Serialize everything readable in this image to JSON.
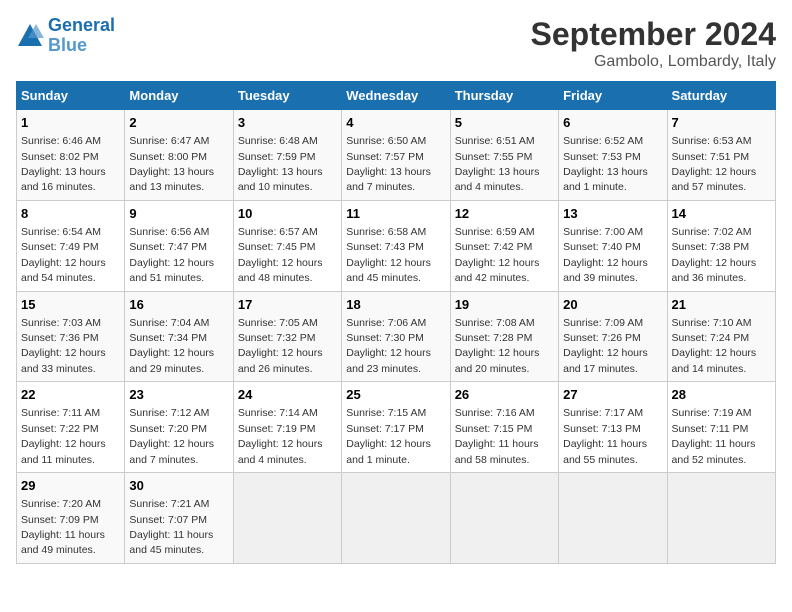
{
  "logo": {
    "line1": "General",
    "line2": "Blue"
  },
  "title": "September 2024",
  "subtitle": "Gambolo, Lombardy, Italy",
  "headers": [
    "Sunday",
    "Monday",
    "Tuesday",
    "Wednesday",
    "Thursday",
    "Friday",
    "Saturday"
  ],
  "weeks": [
    [
      {
        "day": "1",
        "sunrise": "Sunrise: 6:46 AM",
        "sunset": "Sunset: 8:02 PM",
        "daylight": "Daylight: 13 hours and 16 minutes."
      },
      {
        "day": "2",
        "sunrise": "Sunrise: 6:47 AM",
        "sunset": "Sunset: 8:00 PM",
        "daylight": "Daylight: 13 hours and 13 minutes."
      },
      {
        "day": "3",
        "sunrise": "Sunrise: 6:48 AM",
        "sunset": "Sunset: 7:59 PM",
        "daylight": "Daylight: 13 hours and 10 minutes."
      },
      {
        "day": "4",
        "sunrise": "Sunrise: 6:50 AM",
        "sunset": "Sunset: 7:57 PM",
        "daylight": "Daylight: 13 hours and 7 minutes."
      },
      {
        "day": "5",
        "sunrise": "Sunrise: 6:51 AM",
        "sunset": "Sunset: 7:55 PM",
        "daylight": "Daylight: 13 hours and 4 minutes."
      },
      {
        "day": "6",
        "sunrise": "Sunrise: 6:52 AM",
        "sunset": "Sunset: 7:53 PM",
        "daylight": "Daylight: 13 hours and 1 minute."
      },
      {
        "day": "7",
        "sunrise": "Sunrise: 6:53 AM",
        "sunset": "Sunset: 7:51 PM",
        "daylight": "Daylight: 12 hours and 57 minutes."
      }
    ],
    [
      {
        "day": "8",
        "sunrise": "Sunrise: 6:54 AM",
        "sunset": "Sunset: 7:49 PM",
        "daylight": "Daylight: 12 hours and 54 minutes."
      },
      {
        "day": "9",
        "sunrise": "Sunrise: 6:56 AM",
        "sunset": "Sunset: 7:47 PM",
        "daylight": "Daylight: 12 hours and 51 minutes."
      },
      {
        "day": "10",
        "sunrise": "Sunrise: 6:57 AM",
        "sunset": "Sunset: 7:45 PM",
        "daylight": "Daylight: 12 hours and 48 minutes."
      },
      {
        "day": "11",
        "sunrise": "Sunrise: 6:58 AM",
        "sunset": "Sunset: 7:43 PM",
        "daylight": "Daylight: 12 hours and 45 minutes."
      },
      {
        "day": "12",
        "sunrise": "Sunrise: 6:59 AM",
        "sunset": "Sunset: 7:42 PM",
        "daylight": "Daylight: 12 hours and 42 minutes."
      },
      {
        "day": "13",
        "sunrise": "Sunrise: 7:00 AM",
        "sunset": "Sunset: 7:40 PM",
        "daylight": "Daylight: 12 hours and 39 minutes."
      },
      {
        "day": "14",
        "sunrise": "Sunrise: 7:02 AM",
        "sunset": "Sunset: 7:38 PM",
        "daylight": "Daylight: 12 hours and 36 minutes."
      }
    ],
    [
      {
        "day": "15",
        "sunrise": "Sunrise: 7:03 AM",
        "sunset": "Sunset: 7:36 PM",
        "daylight": "Daylight: 12 hours and 33 minutes."
      },
      {
        "day": "16",
        "sunrise": "Sunrise: 7:04 AM",
        "sunset": "Sunset: 7:34 PM",
        "daylight": "Daylight: 12 hours and 29 minutes."
      },
      {
        "day": "17",
        "sunrise": "Sunrise: 7:05 AM",
        "sunset": "Sunset: 7:32 PM",
        "daylight": "Daylight: 12 hours and 26 minutes."
      },
      {
        "day": "18",
        "sunrise": "Sunrise: 7:06 AM",
        "sunset": "Sunset: 7:30 PM",
        "daylight": "Daylight: 12 hours and 23 minutes."
      },
      {
        "day": "19",
        "sunrise": "Sunrise: 7:08 AM",
        "sunset": "Sunset: 7:28 PM",
        "daylight": "Daylight: 12 hours and 20 minutes."
      },
      {
        "day": "20",
        "sunrise": "Sunrise: 7:09 AM",
        "sunset": "Sunset: 7:26 PM",
        "daylight": "Daylight: 12 hours and 17 minutes."
      },
      {
        "day": "21",
        "sunrise": "Sunrise: 7:10 AM",
        "sunset": "Sunset: 7:24 PM",
        "daylight": "Daylight: 12 hours and 14 minutes."
      }
    ],
    [
      {
        "day": "22",
        "sunrise": "Sunrise: 7:11 AM",
        "sunset": "Sunset: 7:22 PM",
        "daylight": "Daylight: 12 hours and 11 minutes."
      },
      {
        "day": "23",
        "sunrise": "Sunrise: 7:12 AM",
        "sunset": "Sunset: 7:20 PM",
        "daylight": "Daylight: 12 hours and 7 minutes."
      },
      {
        "day": "24",
        "sunrise": "Sunrise: 7:14 AM",
        "sunset": "Sunset: 7:19 PM",
        "daylight": "Daylight: 12 hours and 4 minutes."
      },
      {
        "day": "25",
        "sunrise": "Sunrise: 7:15 AM",
        "sunset": "Sunset: 7:17 PM",
        "daylight": "Daylight: 12 hours and 1 minute."
      },
      {
        "day": "26",
        "sunrise": "Sunrise: 7:16 AM",
        "sunset": "Sunset: 7:15 PM",
        "daylight": "Daylight: 11 hours and 58 minutes."
      },
      {
        "day": "27",
        "sunrise": "Sunrise: 7:17 AM",
        "sunset": "Sunset: 7:13 PM",
        "daylight": "Daylight: 11 hours and 55 minutes."
      },
      {
        "day": "28",
        "sunrise": "Sunrise: 7:19 AM",
        "sunset": "Sunset: 7:11 PM",
        "daylight": "Daylight: 11 hours and 52 minutes."
      }
    ],
    [
      {
        "day": "29",
        "sunrise": "Sunrise: 7:20 AM",
        "sunset": "Sunset: 7:09 PM",
        "daylight": "Daylight: 11 hours and 49 minutes."
      },
      {
        "day": "30",
        "sunrise": "Sunrise: 7:21 AM",
        "sunset": "Sunset: 7:07 PM",
        "daylight": "Daylight: 11 hours and 45 minutes."
      },
      null,
      null,
      null,
      null,
      null
    ]
  ]
}
